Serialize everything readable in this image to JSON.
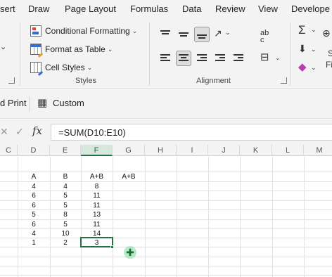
{
  "tabs": [
    "sert",
    "Draw",
    "Page Layout",
    "Formulas",
    "Data",
    "Review",
    "View",
    "Develope"
  ],
  "styles_group": {
    "conditional_formatting": "Conditional Formatting",
    "format_as_table": "Format as Table",
    "cell_styles": "Cell Styles",
    "label": "Styles"
  },
  "alignment_group": {
    "label": "Alignment",
    "wrap_text_icon": "ab\nc",
    "selected_vertical": "middle-align",
    "selected_horizontal": "center-align"
  },
  "editing_group": {
    "sigma_icon": "Σ",
    "partial_labels": [
      "S",
      "Fi"
    ]
  },
  "quickbar": {
    "print_label": "d Print",
    "custom_label": "Custom"
  },
  "formula_bar": {
    "cancel_icon": "✕",
    "enter_icon": "✓",
    "fx_icon": "fx",
    "formula": "=SUM(D10:E10)"
  },
  "grid": {
    "columns": [
      "C",
      "D",
      "E",
      "F",
      "G",
      "H",
      "I",
      "J",
      "K",
      "L",
      "M"
    ],
    "active_column": "F",
    "headers_row": [
      "A",
      "B",
      "A+B",
      "A+B"
    ],
    "rows": [
      [
        "4",
        "4",
        "8"
      ],
      [
        "6",
        "5",
        "11"
      ],
      [
        "6",
        "5",
        "11"
      ],
      [
        "5",
        "8",
        "13"
      ],
      [
        "6",
        "5",
        "11"
      ],
      [
        "4",
        "10",
        "14"
      ],
      [
        "1",
        "2",
        "3"
      ]
    ]
  },
  "colors": {
    "ribbon_bg": "#f3f3f3",
    "excel_green": "#217346",
    "gridline": "#e1e1e1"
  }
}
